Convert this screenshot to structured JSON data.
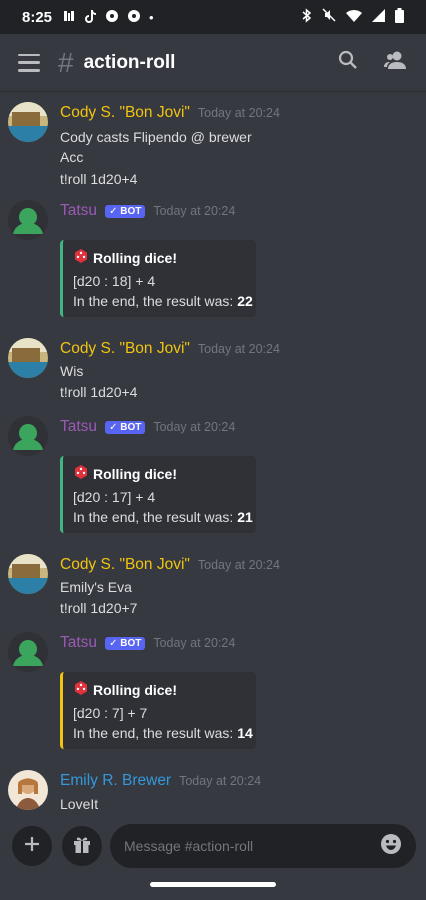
{
  "status": {
    "time": "8:25",
    "dot": "•"
  },
  "header": {
    "hash": "#",
    "title": "action-roll"
  },
  "messages": [
    {
      "author": "Cody S. \"Bon Jovi\"",
      "time": "Today at 20:24",
      "lines": [
        "Cody casts Flipendo @ brewer",
        "Acc",
        "t!roll 1d20+4"
      ]
    },
    {
      "author": "Tatsu",
      "bot": "✓ BOT",
      "time": "Today at 20:24",
      "embed": {
        "title": "Rolling dice!",
        "roll_a": "[d20 : 18] + 4",
        "result_label": "In the end, the result was: ",
        "result": "22"
      }
    },
    {
      "author": "Cody S. \"Bon Jovi\"",
      "time": "Today at 20:24",
      "lines": [
        "Wis",
        "t!roll 1d20+4"
      ]
    },
    {
      "author": "Tatsu",
      "bot": "✓ BOT",
      "time": "Today at 20:24",
      "embed": {
        "title": "Rolling dice!",
        "roll_a": "[d20 : 17] + 4",
        "result_label": "In the end, the result was: ",
        "result": "21"
      }
    },
    {
      "author": "Cody S. \"Bon Jovi\"",
      "time": "Today at 20:24",
      "lines": [
        "Emily's Eva",
        "t!roll 1d20+7"
      ]
    },
    {
      "author": "Tatsu",
      "bot": "✓ BOT",
      "time": "Today at 20:24",
      "embed": {
        "title": "Rolling dice!",
        "roll_a": "[d20 : 7] + 7",
        "result_label": "In the end, the result was: ",
        "result": "14"
      }
    },
    {
      "author": "Emily R. Brewer",
      "time": "Today at 20:24",
      "lines": [
        "LoveIt"
      ]
    }
  ],
  "composer": {
    "placeholder": "Message #action-roll"
  },
  "colors": {
    "cody": "#f1c40f",
    "tatsu": "#9b59b6",
    "emily": "#3498db",
    "embed_green": "#43b581",
    "embed_yellow": "#f1c40f"
  }
}
